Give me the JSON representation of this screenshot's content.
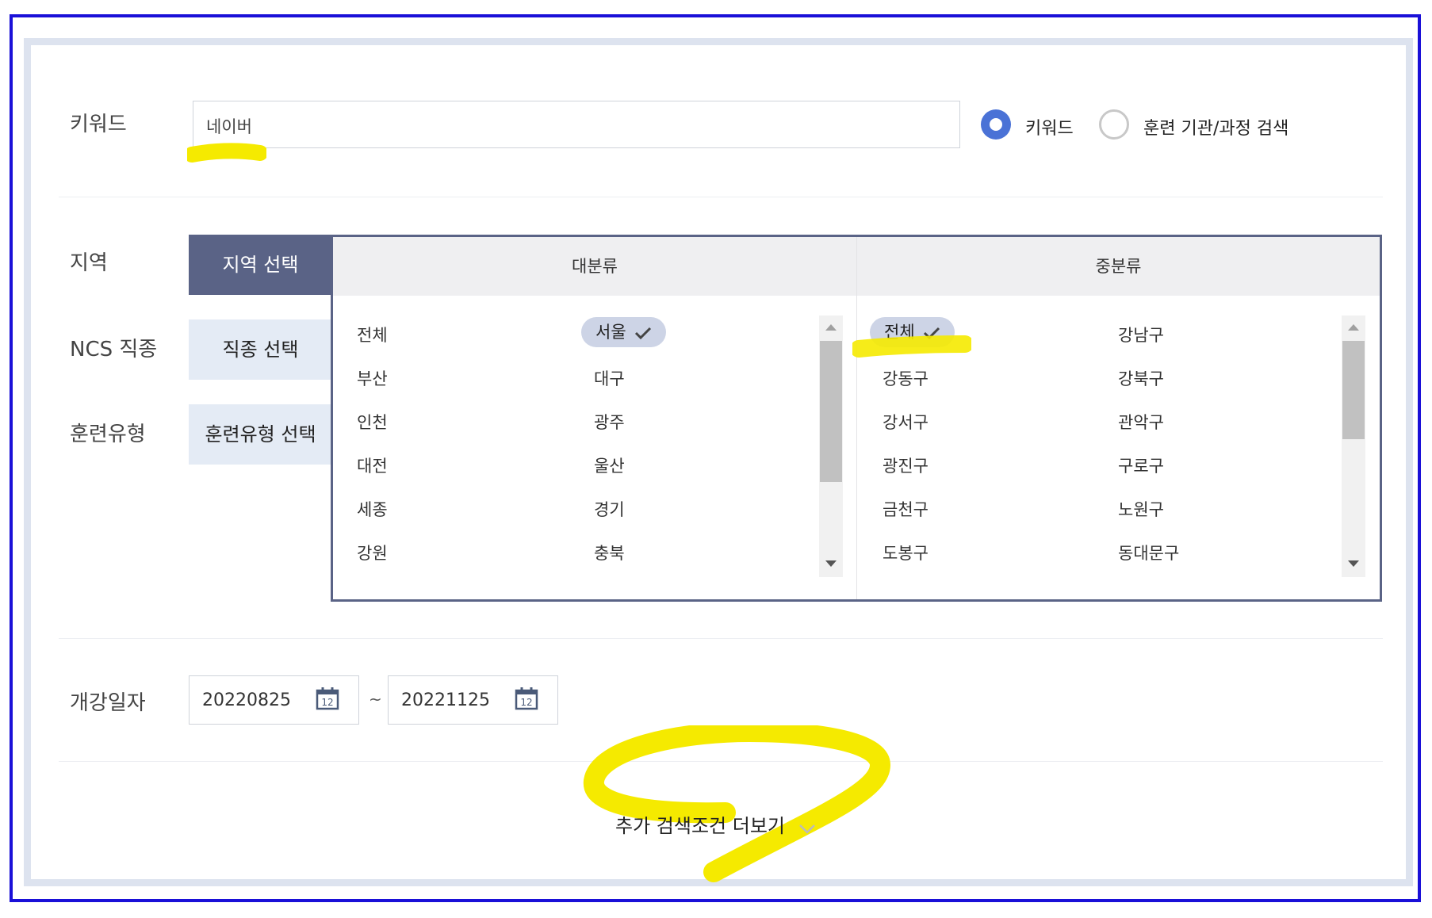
{
  "keyword": {
    "label": "키워드",
    "input_value": "네이버",
    "radio_options": [
      {
        "label": "키워드",
        "selected": true
      },
      {
        "label": "훈련 기관/과정 검색",
        "selected": false
      }
    ]
  },
  "filters": {
    "region_label": "지역",
    "ncs_label": "NCS 직종",
    "training_type_label": "훈련유형",
    "tabs": {
      "region": "지역 선택",
      "job": "직종 선택",
      "training_type": "훈련유형 선택"
    }
  },
  "region_selector": {
    "major": {
      "header": "대분류",
      "items": [
        "전체",
        "서울",
        "부산",
        "대구",
        "인천",
        "광주",
        "대전",
        "울산",
        "세종",
        "경기",
        "강원",
        "충북"
      ],
      "selected": "서울"
    },
    "middle": {
      "header": "중분류",
      "items": [
        "전체",
        "강남구",
        "강동구",
        "강북구",
        "강서구",
        "관악구",
        "광진구",
        "구로구",
        "금천구",
        "노원구",
        "도봉구",
        "동대문구"
      ],
      "selected": "전체"
    }
  },
  "date": {
    "label": "개강일자",
    "start": "20220825",
    "end": "20221125",
    "separator": "~",
    "calendar_icon_text": "12"
  },
  "more": {
    "label": "추가 검색조건 더보기"
  },
  "colors": {
    "frame": "#1a10d8",
    "accent_tab": "#5a6386",
    "radio_on": "#4a72d6",
    "highlight": "#f5ea00"
  }
}
